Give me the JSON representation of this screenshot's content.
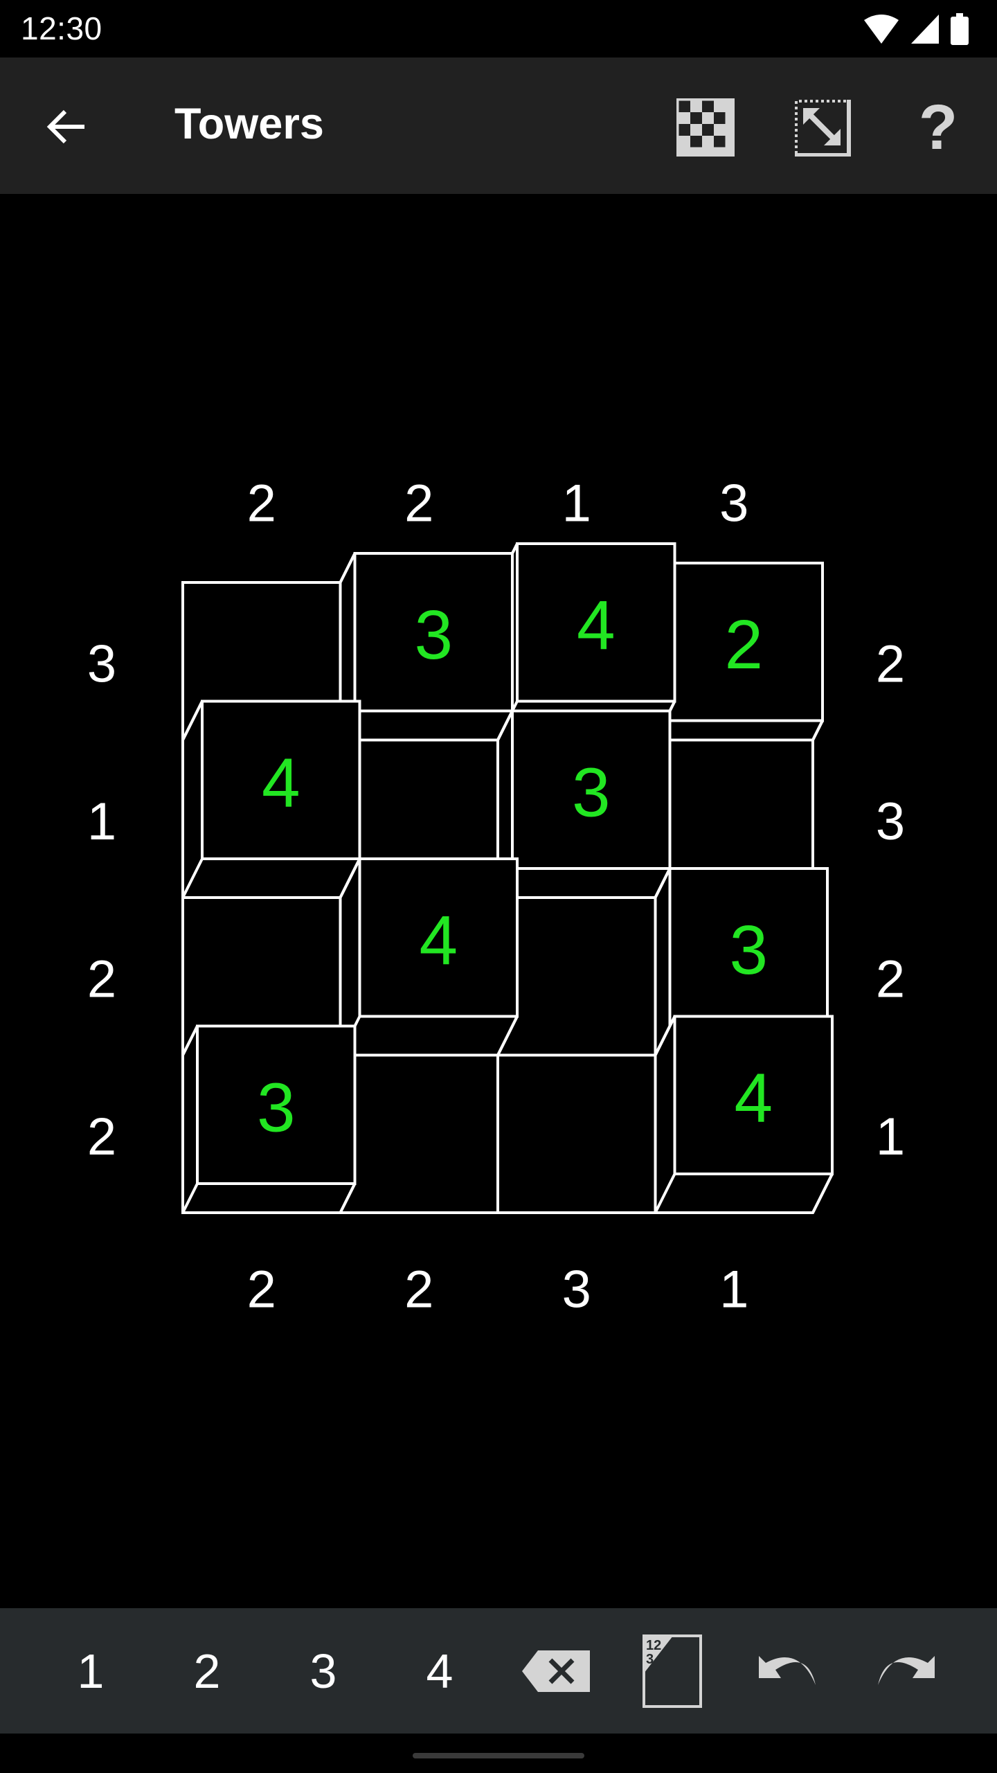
{
  "status_bar": {
    "time": "12:30",
    "icons": [
      "wifi-icon",
      "cell-signal-icon",
      "battery-icon"
    ]
  },
  "app_bar": {
    "back_icon": "arrow-back-icon",
    "title": "Towers",
    "actions": [
      {
        "name": "new-game-button",
        "icon": "checkerboard-icon"
      },
      {
        "name": "resize-button",
        "icon": "expand-icon"
      },
      {
        "name": "help-button",
        "icon": "help-icon",
        "glyph": "?"
      }
    ]
  },
  "puzzle": {
    "size": 4,
    "clues": {
      "top": [
        "2",
        "2",
        "1",
        "3"
      ],
      "bottom": [
        "2",
        "2",
        "3",
        "1"
      ],
      "left": [
        "3",
        "1",
        "2",
        "2"
      ],
      "right": [
        "2",
        "3",
        "2",
        "1"
      ]
    },
    "grid": [
      [
        0,
        3,
        4,
        2
      ],
      [
        4,
        0,
        3,
        0
      ],
      [
        0,
        4,
        0,
        3
      ],
      [
        3,
        0,
        0,
        4
      ]
    ],
    "colors": {
      "entry": "#22e622",
      "line": "#ffffff",
      "clue": "#ffffff"
    }
  },
  "bottom_bar": {
    "digits": [
      "1",
      "2",
      "3",
      "4"
    ],
    "tools": [
      {
        "name": "erase-button",
        "icon": "backspace-icon"
      },
      {
        "name": "notes-mode-button",
        "icon": "pencil-marks-icon",
        "label": "12 3"
      },
      {
        "name": "undo-button",
        "icon": "undo-icon"
      },
      {
        "name": "redo-button",
        "icon": "redo-icon"
      }
    ]
  }
}
